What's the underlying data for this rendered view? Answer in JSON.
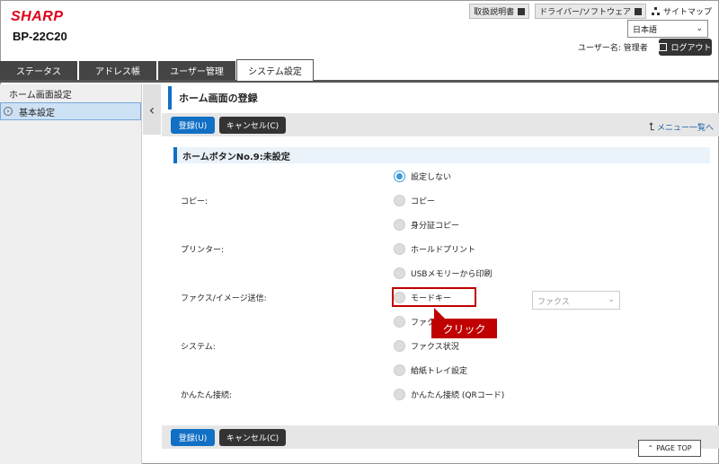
{
  "header": {
    "logo": "SHARP",
    "model": "BP-22C20",
    "links": [
      "取扱説明書",
      "ドライバー/ソフトウェア"
    ],
    "sitemap": "サイトマップ",
    "language": "日本語",
    "user_label": "ユーザー名: 管理者",
    "logout": "ログアウト"
  },
  "tabs": [
    {
      "label": "ステータス"
    },
    {
      "label": "アドレス帳"
    },
    {
      "label": "ユーザー管理"
    },
    {
      "label": "システム設定",
      "active": true
    }
  ],
  "sidebar": {
    "items": [
      {
        "label": "ホーム画面設定"
      },
      {
        "label": "基本設定",
        "selected": true
      }
    ]
  },
  "main": {
    "title": "ホーム画面の登録",
    "register_button": "登録(U)",
    "cancel_button": "キャンセル(C)",
    "menu_link": "メニュー一覧へ",
    "section_title": "ホームボタンNo.9:未設定",
    "groups": {
      "copy": "コピー:",
      "printer": "プリンター:",
      "fax": "ファクス/イメージ送信:",
      "system": "システム:",
      "easy": "かんたん接続:"
    },
    "options": {
      "none": "設定しない",
      "copy": "コピー",
      "id_copy": "身分証コピー",
      "hold_print": "ホールドプリント",
      "usb_print": "USBメモリーから印刷",
      "mode_key": "モードキー",
      "fax_partial": "ファク",
      "fax_status": "ファクス状況",
      "tray": "給紙トレイ設定",
      "qr": "かんたん接続 (QRコード)"
    },
    "selected_option": "none",
    "dest_select": "ファクス",
    "callout": "クリック",
    "page_top": "PAGE TOP"
  }
}
